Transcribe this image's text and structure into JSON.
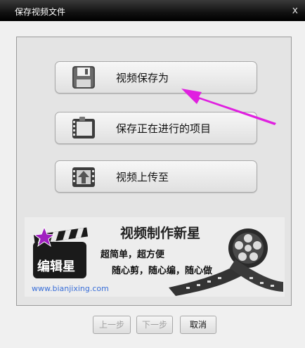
{
  "window": {
    "title": "保存视频文件",
    "close_glyph": "x"
  },
  "options": [
    {
      "label": "视频保存为",
      "icon": "floppy-disk-icon"
    },
    {
      "label": "保存正在进行的项目",
      "icon": "film-reel-folder-icon"
    },
    {
      "label": "视频上传至",
      "icon": "upload-film-icon"
    }
  ],
  "banner": {
    "logo_text": "编辑星",
    "headline": "视频制作新星",
    "line1": "超简单，超方便",
    "line2": "随心剪，随心编，随心做",
    "url": "www.bianjixing.com"
  },
  "footer": {
    "prev_label": "上一步",
    "next_label": "下一步",
    "cancel_label": "取消"
  },
  "colors": {
    "accent_arrow": "#e020e0",
    "titlebar": "#111111",
    "url_color": "#3a6fd8"
  }
}
